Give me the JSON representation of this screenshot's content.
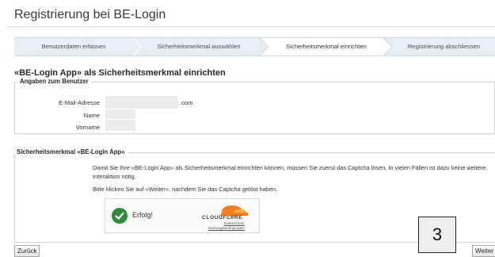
{
  "page": {
    "title": "Registrierung bei BE-Login"
  },
  "steps": [
    {
      "label": "Benutzerdaten erfassen",
      "active": false
    },
    {
      "label": "Sicherheitsmerkmal auswählen",
      "active": false
    },
    {
      "label": "Sicherheitsmerkmal einrichten",
      "active": true
    },
    {
      "label": "Registrierung abschliessen",
      "active": false
    }
  ],
  "main": {
    "heading": "«BE-Login App» als Sicherheitsmerkmal einrichten",
    "user_section": {
      "legend": "Angaben zum Benutzer",
      "email_label": "E-Mail-Adresse",
      "email_suffix": ".com",
      "name_label": "Name",
      "firstname_label": "Vorname"
    },
    "security_section": {
      "legend": "Sicherheitsmerkmal «BE-Login App»",
      "text1": "Damit Sie Ihre «BE-Login App» als Sicherheitsmerkmal einrichten können, müssen Sie zuerst das Captcha lösen. In vielen Fällen ist dazu keine weitere Interaktion nötig.",
      "text2": "Bitte klicken Sie auf «Weiter», nachdem Sie das Captcha gelöst haben."
    },
    "captcha": {
      "status": "Erfolg!",
      "brand": "CLOUDFLARE",
      "link_privacy": "Datenschutz",
      "link_terms": "Nutzungsbedingungen",
      "accent": "#f38020",
      "success_color": "#2f8a3a"
    }
  },
  "badge": {
    "value": "3"
  },
  "buttons": {
    "back": "Zurück",
    "next": "Weiter"
  }
}
